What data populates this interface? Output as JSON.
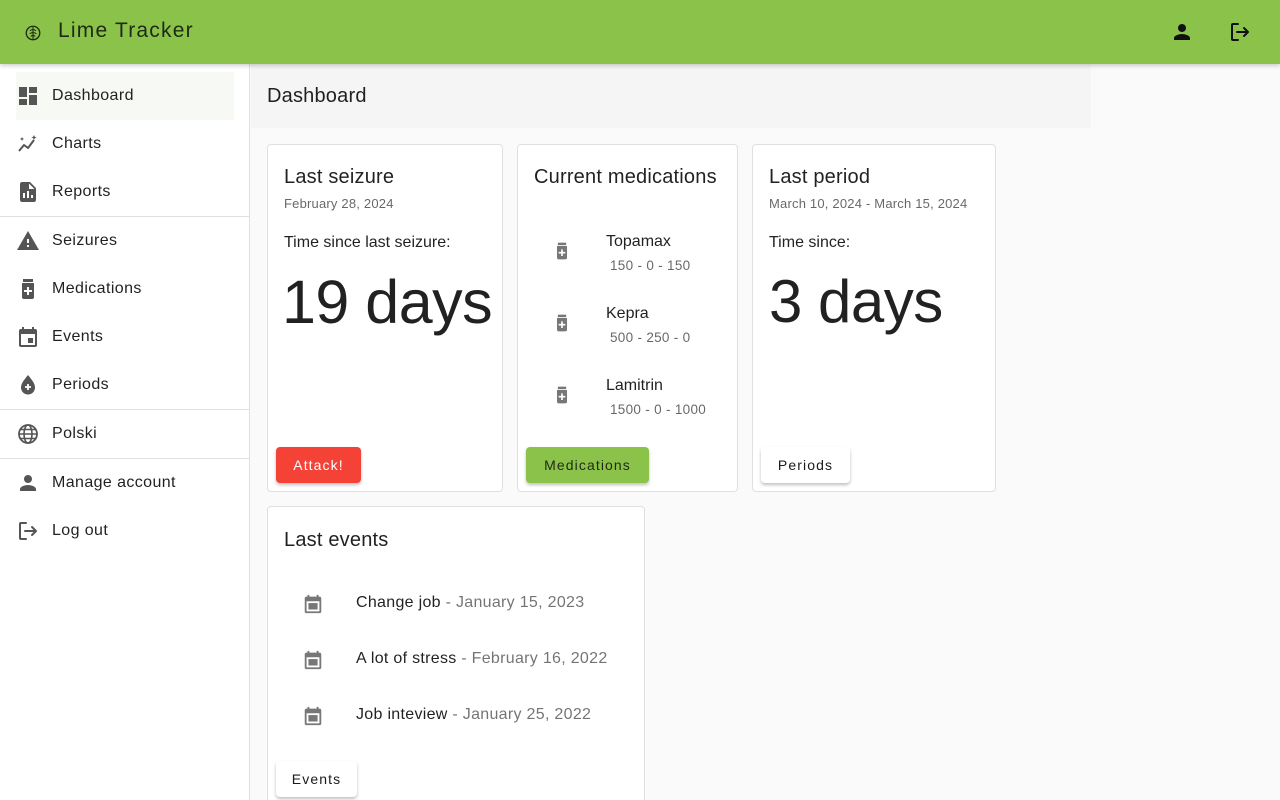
{
  "app": {
    "title": "Lime Tracker",
    "logo_icon": "brain-icon",
    "accent_color": "#8bc34a",
    "account_icon": "person-icon",
    "logout_icon": "logout-icon"
  },
  "sidebar": {
    "groups": [
      [
        {
          "label": "Dashboard",
          "icon": "dashboard-icon",
          "active": true
        },
        {
          "label": "Charts",
          "icon": "auto-graph-icon"
        },
        {
          "label": "Reports",
          "icon": "report-document-icon"
        }
      ],
      [
        {
          "label": "Seizures",
          "icon": "warning-icon"
        },
        {
          "label": "Medications",
          "icon": "medication-icon"
        },
        {
          "label": "Events",
          "icon": "calendar-icon"
        },
        {
          "label": "Periods",
          "icon": "blood-drop-icon"
        }
      ],
      [
        {
          "label": "Polski",
          "icon": "globe-icon"
        }
      ],
      [
        {
          "label": "Manage account",
          "icon": "person-icon"
        },
        {
          "label": "Log out",
          "icon": "logout-icon"
        }
      ]
    ]
  },
  "page": {
    "title": "Dashboard"
  },
  "cards": {
    "last_seizure": {
      "title": "Last seizure",
      "date": "February 28, 2024",
      "label": "Time since last seizure:",
      "value": "19 days",
      "button": "Attack!",
      "button_color": "#f44336"
    },
    "medications": {
      "title": "Current medications",
      "items": [
        {
          "name": "Topamax",
          "dose": "150 - 0 - 150"
        },
        {
          "name": "Kepra",
          "dose": "500 - 250 - 0"
        },
        {
          "name": "Lamitrin",
          "dose": "1500 - 0 - 1000"
        }
      ],
      "button": "Medications"
    },
    "last_period": {
      "title": "Last period",
      "date": "March 10, 2024 - March 15, 2024",
      "label": "Time since:",
      "value": "3 days",
      "button": "Periods"
    },
    "last_events": {
      "title": "Last events",
      "items": [
        {
          "name": "Change job",
          "date": " - January 15, 2023"
        },
        {
          "name": "A lot of stress",
          "date": " - February 16, 2022"
        },
        {
          "name": "Job inteview",
          "date": " - January 25, 2022"
        }
      ],
      "button": "Events"
    }
  }
}
